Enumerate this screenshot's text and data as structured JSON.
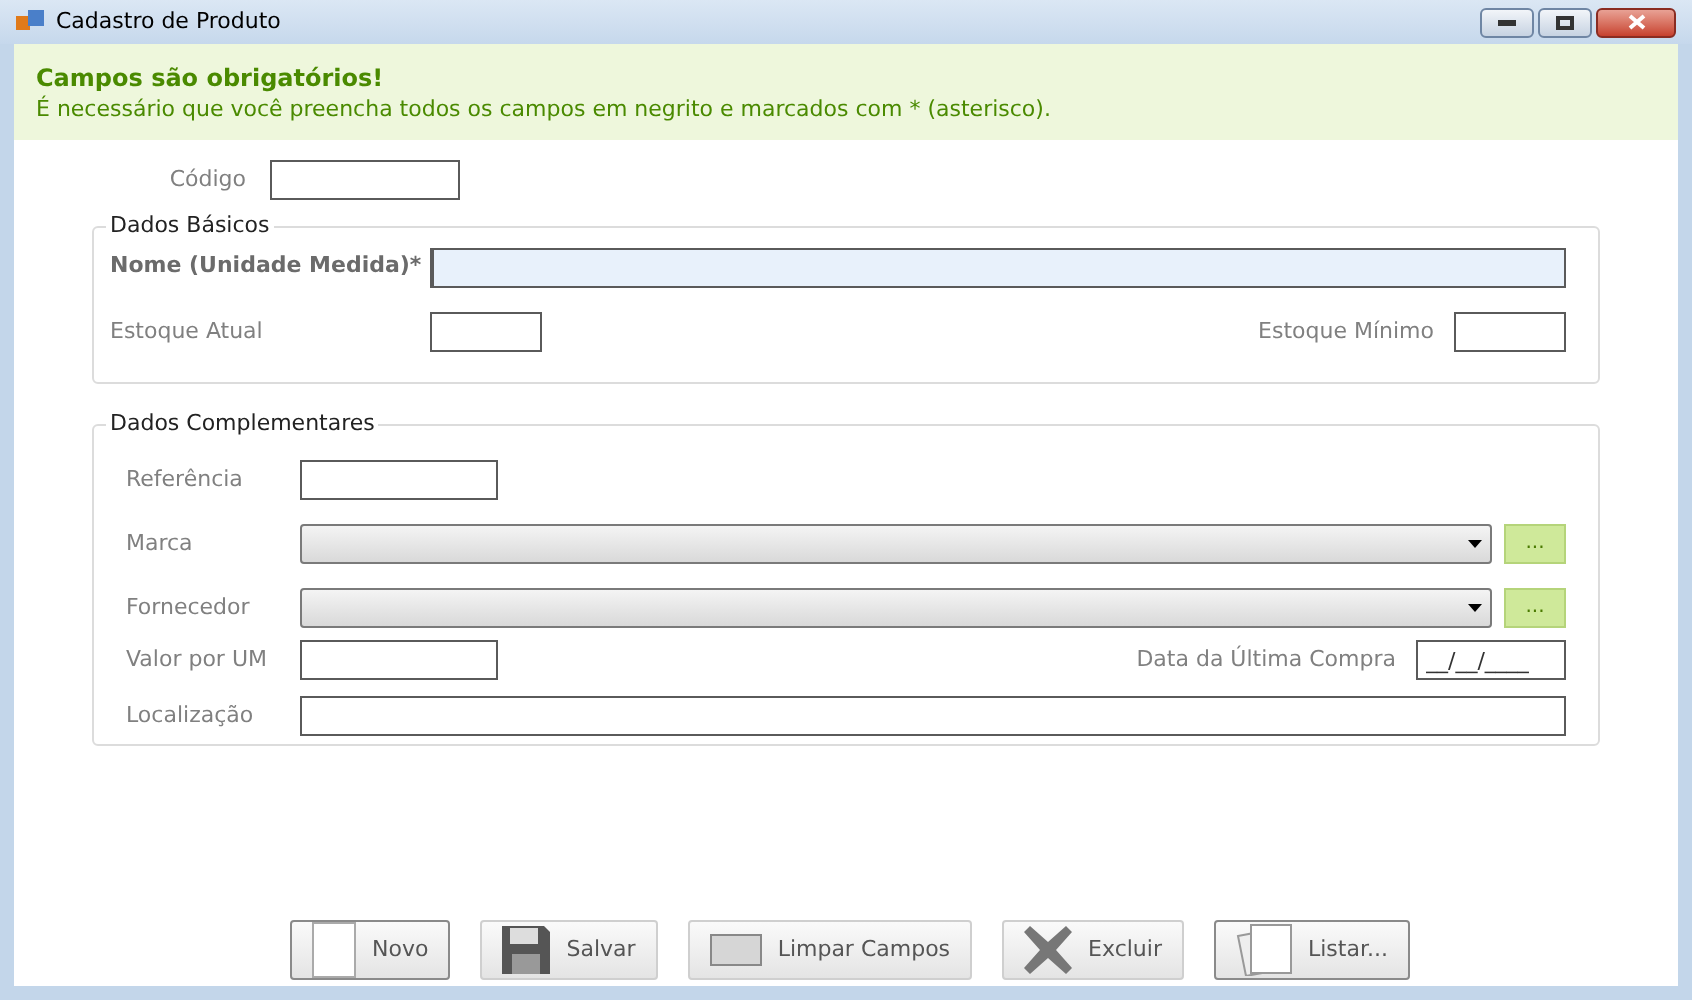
{
  "window": {
    "title": "Cadastro de Produto"
  },
  "banner": {
    "title": "Campos são obrigatórios!",
    "message": "É necessário que você preencha todos os campos em negrito e marcados com * (asterisco)."
  },
  "codigo": {
    "label": "Código"
  },
  "dados_basicos": {
    "title": "Dados Básicos",
    "nome": {
      "label": "Nome (Unidade Medida)*",
      "required": true,
      "focused": true
    },
    "estoque_atual": {
      "label": "Estoque Atual"
    },
    "estoque_minimo": {
      "label": "Estoque Mínimo"
    }
  },
  "dados_complementares": {
    "title": "Dados Complementares",
    "referencia": {
      "label": "Referência"
    },
    "marca": {
      "label": "Marca",
      "browse": "..."
    },
    "fornecedor": {
      "label": "Fornecedor",
      "browse": "..."
    },
    "valor_por_um": {
      "label": "Valor por UM"
    },
    "data_ultima_compra": {
      "label": "Data da Última Compra",
      "value": "__/__/____"
    },
    "localizacao": {
      "label": "Localização"
    }
  },
  "buttons": [
    {
      "kind": "new",
      "label": "Novo",
      "disabled": false
    },
    {
      "kind": "save",
      "label": "Salvar",
      "disabled": true
    },
    {
      "kind": "clear",
      "label": "Limpar Campos",
      "disabled": true
    },
    {
      "kind": "delete",
      "label": "Excluir",
      "disabled": true
    },
    {
      "kind": "list",
      "label": "Listar...",
      "disabled": false
    }
  ]
}
